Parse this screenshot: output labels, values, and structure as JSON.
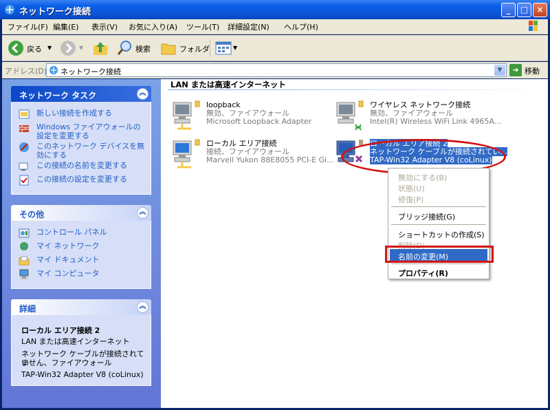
{
  "window": {
    "title": "ネットワーク接続",
    "controls": {
      "minimize": "_",
      "maximize": "□",
      "close": "×"
    }
  },
  "menubar": {
    "items": [
      "ファイル(F)",
      "編集(E)",
      "表示(V)",
      "お気に入り(A)",
      "ツール(T)",
      "詳細設定(N)",
      "ヘルプ(H)"
    ]
  },
  "toolbar": {
    "back_label": "戻る",
    "search_label": "検索",
    "folder_label": "フォルダ"
  },
  "addressbar": {
    "label": "アドレス(D)",
    "value": "ネットワーク接続",
    "go_label": "移動"
  },
  "tasks_panel": {
    "title": "ネットワーク タスク",
    "items": [
      {
        "label": "新しい接続を作成する",
        "icon": "new-connection-icon"
      },
      {
        "label": "Windows ファイアウォールの設定を変更する",
        "icon": "firewall-icon"
      },
      {
        "label": "このネットワーク デバイスを無効にする",
        "icon": "disable-device-icon"
      },
      {
        "label": "この接続の名前を変更する",
        "icon": "rename-icon"
      },
      {
        "label": "この接続の設定を変更する",
        "icon": "settings-icon"
      }
    ]
  },
  "other_panel": {
    "title": "その他",
    "items": [
      {
        "label": "コントロール パネル",
        "icon": "control-panel-icon"
      },
      {
        "label": "マイ ネットワーク",
        "icon": "my-network-icon"
      },
      {
        "label": "マイ ドキュメント",
        "icon": "my-documents-icon"
      },
      {
        "label": "マイ コンピュータ",
        "icon": "my-computer-icon"
      }
    ]
  },
  "details_panel": {
    "title": "詳細",
    "name": "ローカル エリア接続 2",
    "type": "LAN または高速インターネット",
    "status_line1": "ネットワーク ケーブルが接続されてい",
    "status_line2": "ません、ファイアウォール",
    "adapter": "TAP-Win32 Adapter V8 (coLinux)"
  },
  "main": {
    "group_title": "LAN または高速インターネット",
    "connections": [
      {
        "name": "loopback",
        "status": "無効、ファイアウォール",
        "device": "Microsoft Loopback Adapter"
      },
      {
        "name": "ワイヤレス ネットワーク接続",
        "status": "無効、ファイアウォール",
        "device": "Intel(R) Wireless WiFi Link 4965A..."
      },
      {
        "name": "ローカル エリア接続",
        "status": "接続、ファイアウォール",
        "device": "Marvell Yukon 88E8055 PCI-E Gi..."
      },
      {
        "name": "ローカル エリア接続 2",
        "status": "ネットワーク ケーブルが接続されてい...",
        "device": "TAP-Win32 Adapter V8 (coLinux)"
      }
    ]
  },
  "context_menu": {
    "items": [
      {
        "label": "無効にする(B)",
        "state": "disabled"
      },
      {
        "label": "状態(U)",
        "state": "disabled"
      },
      {
        "label": "修復(P)",
        "state": "disabled"
      },
      {
        "label": "ブリッジ接続(G)",
        "state": "normal"
      },
      {
        "label": "ショートカットの作成(S)",
        "state": "normal"
      },
      {
        "label": "削除(D)",
        "state": "disabled"
      },
      {
        "label": "名前の変更(M)",
        "state": "highlighted"
      },
      {
        "label": "プロパティ(R)",
        "state": "bold"
      }
    ]
  },
  "colors": {
    "titlebar": "#0A5FE8",
    "task_link": "#215DC6",
    "selection": "#316AC5",
    "highlight_red": "#D11414"
  }
}
